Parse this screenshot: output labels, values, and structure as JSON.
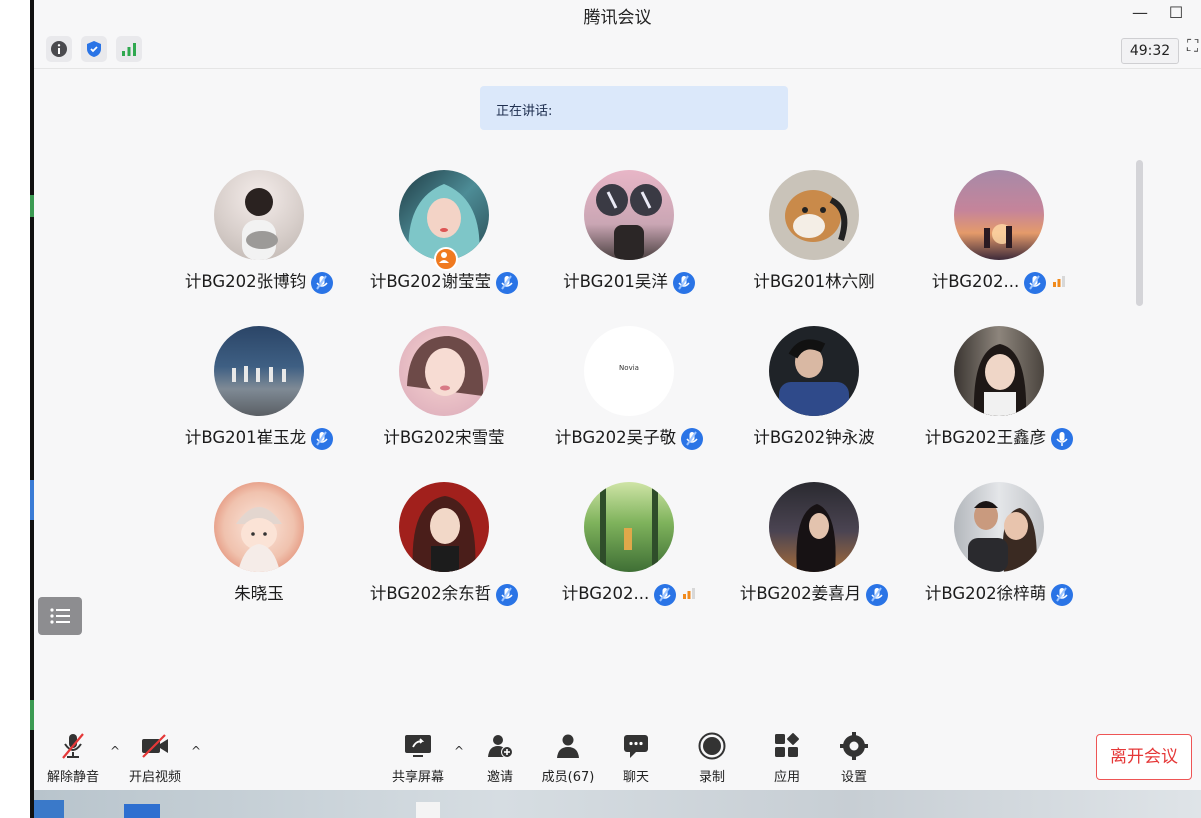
{
  "window": {
    "title": "腾讯会议"
  },
  "toolbar": {
    "timer": "49:32",
    "icons": [
      "info-icon",
      "shield-icon",
      "signal-icon"
    ]
  },
  "speaker": {
    "label": "正在讲话:"
  },
  "participants": [
    {
      "name": "计BG202张博钧",
      "mic": "active"
    },
    {
      "name": "计BG202谢莹莹",
      "mic": "active",
      "host": true
    },
    {
      "name": "计BG201吴洋",
      "mic": "active"
    },
    {
      "name": "计BG201林六刚",
      "mic": "none"
    },
    {
      "name": "计BG202...",
      "mic": "active",
      "signal": "weak"
    },
    {
      "name": "计BG201崔玉龙",
      "mic": "active"
    },
    {
      "name": "计BG202宋雪莹",
      "mic": "none"
    },
    {
      "name": "计BG202吴子敬",
      "mic": "active",
      "avatar_text": "Novia"
    },
    {
      "name": "计BG202钟永波",
      "mic": "none"
    },
    {
      "name": "计BG202王鑫彦",
      "mic": "on"
    },
    {
      "name": "朱晓玉",
      "mic": "none"
    },
    {
      "name": "计BG202余东哲",
      "mic": "active"
    },
    {
      "name": "计BG202...",
      "mic": "active",
      "signal": "weak"
    },
    {
      "name": "计BG202姜喜月",
      "mic": "active"
    },
    {
      "name": "计BG202徐梓萌",
      "mic": "active"
    }
  ],
  "bottombar": {
    "unmute": "解除静音",
    "video": "开启视频",
    "share": "共享屏幕",
    "invite": "邀请",
    "members": "成员(67)",
    "chat": "聊天",
    "record": "录制",
    "apps": "应用",
    "settings": "设置",
    "leave": "离开会议"
  },
  "colors": {
    "accent": "#2a74e6",
    "leave": "#e53838",
    "speaker_bg": "#dbe8fa",
    "host_badge": "#f07a20"
  }
}
